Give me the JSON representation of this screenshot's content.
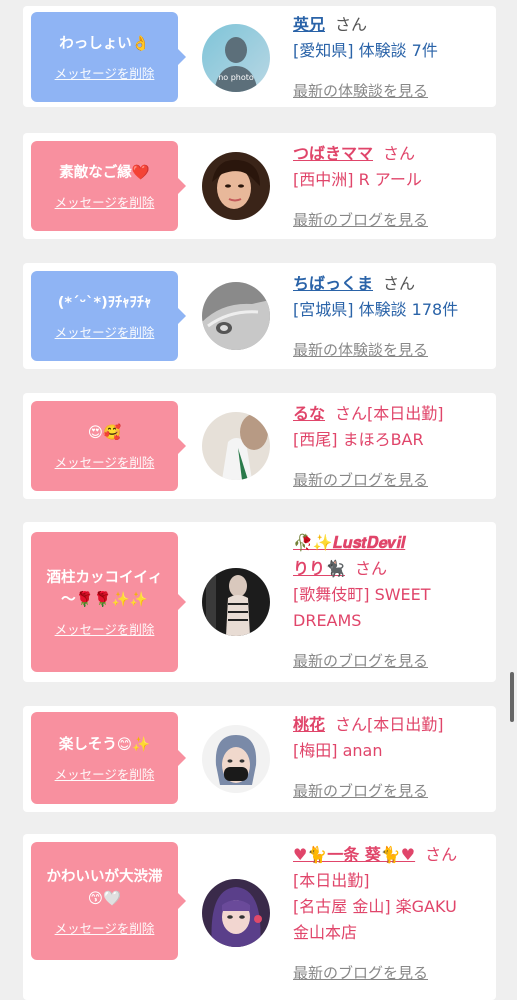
{
  "cards": [
    {
      "message": "わっしょい👌",
      "delete_label": "メッセージを削除",
      "name": "英兄",
      "san": "さん",
      "line1": "[愛知県] 体験談 7件",
      "more": "最新の体験談を見る"
    },
    {
      "message": "素敵なご縁❤️",
      "delete_label": "メッセージを削除",
      "name": "つばきママ",
      "san": "さん",
      "line1": "[西中洲] R アール",
      "more": "最新のブログを見る"
    },
    {
      "message": "(*´ᵕ`*)ｦﾁｬｦﾁｬ",
      "delete_label": "メッセージを削除",
      "name": "ちばっくま",
      "san": "さん",
      "line1": "[宮城県] 体験談 178件",
      "more": "最新の体験談を見る"
    },
    {
      "message": "😍🥰",
      "delete_label": "メッセージを削除",
      "name": "るな",
      "san": "さん[本日出勤]",
      "line1": "[西尾] まほろBAR",
      "more": "最新のブログを見る"
    },
    {
      "message_line1": "酒柱カッコイイィ",
      "message_line2": "〜🌹🌹✨✨",
      "delete_label": "メッセージを削除",
      "name_line1": "🥀✨𝑳𝒖𝒔𝒕𝑫𝒆𝒗𝒊𝒍",
      "name_line2": "りり🐈‍⬛",
      "san": "さん",
      "line1": "[歌舞伎町] SWEET",
      "line2": "DREAMS",
      "more": "最新のブログを見る"
    },
    {
      "message": "楽しそう😊✨",
      "delete_label": "メッセージを削除",
      "name": "桃花",
      "san": "さん[本日出勤]",
      "line1": "[梅田] anan",
      "more": "最新のブログを見る"
    },
    {
      "message_line1": "かわいいが大渋滞",
      "message_line2": "😙🤍",
      "delete_label": "メッセージを削除",
      "name": "♥🐈一条 葵🐈♥",
      "san": "さん",
      "line1": "[本日出勤]",
      "line2": "[名古屋 金山] 楽GAKU",
      "line3": "金山本店",
      "more": "最新のブログを見る"
    }
  ],
  "avatar_nophoto": "no photo",
  "colors": {
    "blue": "#8fb4f4",
    "pink": "#f8909f",
    "blue_text": "#2a63a8",
    "pink_text": "#e0456a"
  }
}
